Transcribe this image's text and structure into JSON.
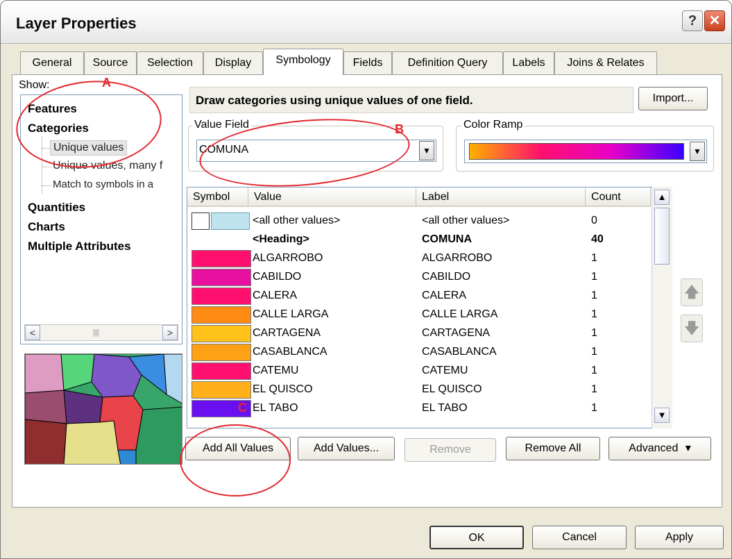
{
  "window": {
    "title": "Layer Properties",
    "help_glyph": "?",
    "close_glyph": "✕"
  },
  "tabs": [
    "General",
    "Source",
    "Selection",
    "Display",
    "Symbology",
    "Fields",
    "Definition Query",
    "Labels",
    "Joins & Relates"
  ],
  "active_tab": "Symbology",
  "show_panel": {
    "label": "Show:",
    "items": [
      {
        "label": "Features",
        "level": 0
      },
      {
        "label": "Categories",
        "level": 0
      },
      {
        "label": "Unique values",
        "level": 1,
        "selected": true
      },
      {
        "label": "Unique values, many f",
        "level": 1
      },
      {
        "label": "Match to symbols in a",
        "level": 1
      },
      {
        "label": "Quantities",
        "level": 0
      },
      {
        "label": "Charts",
        "level": 0
      },
      {
        "label": "Multiple Attributes",
        "level": 0
      }
    ]
  },
  "description": "Draw categories using unique values of one field.",
  "import_label": "Import...",
  "value_field": {
    "legend": "Value Field",
    "value": "COMUNA"
  },
  "color_ramp": {
    "legend": "Color Ramp",
    "colors": [
      "#ffb000",
      "#ff0f6e",
      "#e800c8",
      "#3a00ff"
    ]
  },
  "symbol_table": {
    "headers": {
      "symbol": "Symbol",
      "value": "Value",
      "label": "Label",
      "count": "Count"
    },
    "rows": [
      {
        "value": "<all other values>",
        "label": "<all other values>",
        "count": "0",
        "type": "other"
      },
      {
        "value": "<Heading>",
        "label": "COMUNA",
        "count": "40",
        "type": "heading"
      },
      {
        "color": "#ff0f6e",
        "value": "ALGARROBO",
        "label": "ALGARROBO",
        "count": "1"
      },
      {
        "color": "#e8109e",
        "value": "CABILDO",
        "label": "CABILDO",
        "count": "1"
      },
      {
        "color": "#ff0f6e",
        "value": "CALERA",
        "label": "CALERA",
        "count": "1"
      },
      {
        "color": "#ff8a14",
        "value": "CALLE LARGA",
        "label": "CALLE LARGA",
        "count": "1"
      },
      {
        "color": "#ffc21a",
        "value": "CARTAGENA",
        "label": "CARTAGENA",
        "count": "1"
      },
      {
        "color": "#ffa114",
        "value": "CASABLANCA",
        "label": "CASABLANCA",
        "count": "1"
      },
      {
        "color": "#ff0f6e",
        "value": "CATEMU",
        "label": "CATEMU",
        "count": "1"
      },
      {
        "color": "#ffb01a",
        "value": "EL QUISCO",
        "label": "EL QUISCO",
        "count": "1"
      },
      {
        "color": "#6a10f0",
        "value": "EL TABO",
        "label": "EL TABO",
        "count": "1"
      }
    ]
  },
  "buttons": {
    "add_all": "Add All Values",
    "add_values": "Add Values...",
    "remove": "Remove",
    "remove_all": "Remove All",
    "advanced": "Advanced",
    "advanced_arrow": "▾",
    "ok": "OK",
    "cancel": "Cancel",
    "apply": "Apply"
  },
  "annotations": {
    "a": "A",
    "b": "B",
    "c": "C"
  },
  "accent_red": "#e3262d"
}
